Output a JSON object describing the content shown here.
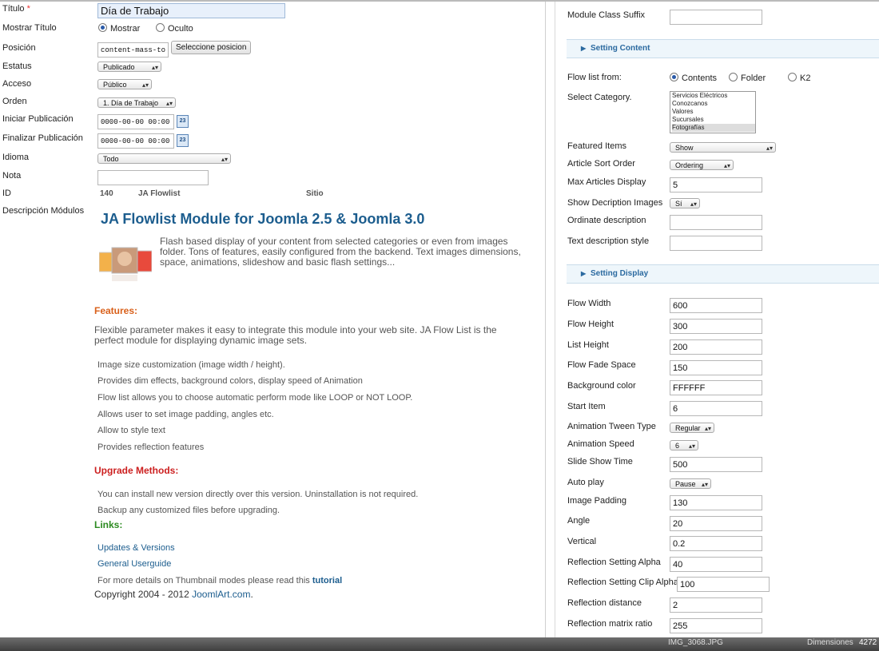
{
  "form": {
    "titulo_label": "Título",
    "titulo_required": "*",
    "titulo_value": "Día de Trabajo",
    "mostrar_label": "Mostrar Título",
    "mostrar_opt1": "Mostrar",
    "mostrar_opt2": "Oculto",
    "posicion_label": "Posición",
    "posicion_value": "content-mass-top",
    "posicion_button": "Seleccione posicion",
    "estatus_label": "Estatus",
    "estatus_value": "Publicado",
    "acceso_label": "Acceso",
    "acceso_value": "Público",
    "orden_label": "Orden",
    "orden_value": "1. Día de Trabajo",
    "iniciar_label": "Iniciar Publicación",
    "iniciar_value": "0000-00-00 00:00:00",
    "finalizar_label": "Finalizar Publicación",
    "finalizar_value": "0000-00-00 00:00:00",
    "cal_icon_text": "23",
    "idioma_label": "Idioma",
    "idioma_value": "Todo",
    "nota_label": "Nota",
    "nota_value": "",
    "id_label": "ID",
    "id_value": "140",
    "id_name": "JA Flowlist",
    "id_site": "Sitio",
    "desc_label": "Descripción Módulos"
  },
  "description": {
    "title": "JA Flowlist Module for Joomla 2.5 & Joomla 3.0",
    "intro": "Flash based display of your content from selected categories or even from images folder. Tons of features, easily configured from the backend. Text images dimensions, space, animations, slideshow and basic flash settings...",
    "features_heading": "Features:",
    "features_paragraph": "Flexible parameter makes it easy to integrate this module into your web site. JA Flow List is the perfect module for displaying dynamic image sets.",
    "features": [
      "Image size customization (image width / height).",
      "Provides dim effects, background colors, display speed of Animation",
      "Flow list allows you to choose automatic perform mode like LOOP or NOT LOOP.",
      "Allows user to set image padding, angles etc.",
      "Allow to style text",
      "Provides reflection features"
    ],
    "upgrade_heading": "Upgrade Methods:",
    "upgrade": [
      "You can install new version directly over this version. Uninstallation is not required.",
      "Backup any customized files before upgrading."
    ],
    "links_heading": "Links:",
    "links": [
      "Updates & Versions",
      "General Userguide"
    ],
    "details_text": "For more details on Thumbnail modes please read this",
    "details_link": "tutorial",
    "copyright_text": "Copyright 2004 - 2012",
    "copyright_link": "JoomlArt.com",
    "copyright_end": "."
  },
  "right": {
    "suffix_label": "Module Class Suffix",
    "suffix_value": "",
    "section_content": "Setting Content",
    "flow_from_label": "Flow list from:",
    "flow_opt1": "Contents",
    "flow_opt2": "Folder",
    "flow_opt3": "K2",
    "category_label": "Select Category.",
    "categories": [
      "Servicios Eléctricos",
      "Conozcanos",
      "Valores",
      "Sucursales",
      "Fotografías"
    ],
    "featured_label": "Featured Items",
    "featured_value": "Show",
    "sort_label": "Article Sort Order",
    "sort_value": "Ordering",
    "max_label": "Max Articles Display",
    "max_value": "5",
    "showdesc_label": "Show Decription Images",
    "showdesc_value": "Sí",
    "ordinate_label": "Ordinate description",
    "ordinate_value": "",
    "textstyle_label": "Text description style",
    "textstyle_value": "",
    "section_display": "Setting Display",
    "flow_width_label": "Flow Width",
    "flow_width": "600",
    "flow_height_label": "Flow Height",
    "flow_height": "300",
    "list_height_label": "List Height",
    "list_height": "200",
    "fade_label": "Flow Fade Space",
    "fade": "150",
    "bg_label": "Background color",
    "bg": "FFFFFF",
    "start_label": "Start Item",
    "start": "6",
    "tween_label": "Animation Tween Type",
    "tween": "Regular",
    "speed_label": "Animation Speed",
    "speed": "6",
    "slide_label": "Slide Show Time",
    "slide": "500",
    "autoplay_label": "Auto play",
    "autoplay": "Pause",
    "padding_label": "Image Padding",
    "padding": "130",
    "angle_label": "Angle",
    "angle": "20",
    "vertical_label": "Vertical",
    "vertical": "0.2",
    "alpha_label": "Reflection Setting Alpha",
    "alpha": "40",
    "clip_label": "Reflection Setting Clip Alpha",
    "clip": "100",
    "distance_label": "Reflection distance",
    "distance": "2",
    "matrix_label": "Reflection matrix ratio",
    "matrix": "255"
  },
  "taskbar": {
    "file1": "IMG_3068.JPG",
    "dims_label": "Dimensiones",
    "dims_value": "4272"
  }
}
